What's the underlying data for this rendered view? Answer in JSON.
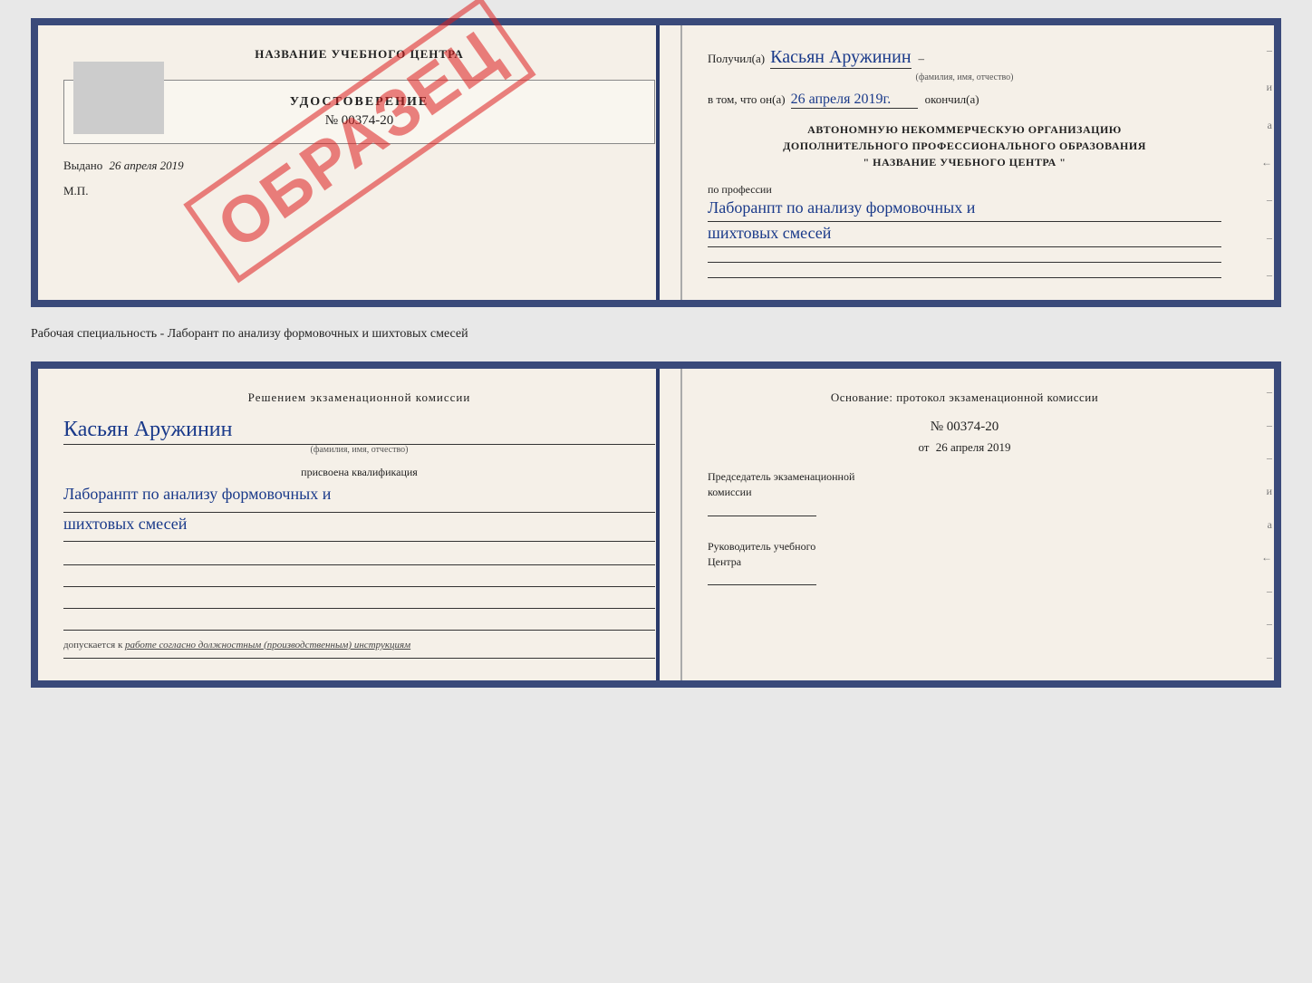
{
  "top_book": {
    "left": {
      "title": "НАЗВАНИЕ УЧЕБНОГО ЦЕНТРА",
      "udostoverenie_label": "УДОСТОВЕРЕНИЕ",
      "number": "№ 00374-20",
      "obrazec": "ОБРАЗЕЦ",
      "vydano_prefix": "Выдано",
      "vydano_date": "26 апреля 2019",
      "mp": "М.П."
    },
    "right": {
      "poluchil_label": "Получил(а)",
      "name_handwritten": "Касьян Аружинин",
      "fio_sublabel": "(фамилия, имя, отчество)",
      "vtom_label": "в том, что он(а)",
      "date_handwritten": "26 апреля 2019г.",
      "okonchil_label": "окончил(а)",
      "org_line1": "АВТОНОМНУЮ НЕКОММЕРЧЕСКУЮ ОРГАНИЗАЦИЮ",
      "org_line2": "ДОПОЛНИТЕЛЬНОГО ПРОФЕССИОНАЛЬНОГО ОБРАЗОВАНИЯ",
      "org_line3": "\"  НАЗВАНИЕ УЧЕБНОГО ЦЕНТРА  \"",
      "po_professii": "по профессии",
      "profession_handwritten_1": "Лаборанпт по анализу формовочных и",
      "profession_handwritten_2": "шихтовых смесей",
      "margin_letters": [
        "и",
        "а",
        "←",
        "–",
        "–",
        "–"
      ]
    }
  },
  "specialty_label": "Рабочая специальность - Лаборант по анализу формовочных и шихтовых смесей",
  "bottom_book": {
    "left": {
      "resolution": "Решением экзаменационной комиссии",
      "name_handwritten": "Касьян Аружинин",
      "fio_sublabel": "(фамилия, имя, отчество)",
      "prisvoena": "присвоена квалификация",
      "qualification_1": "Лаборанпт по анализу формовочных и",
      "qualification_2": "шихтовых смесей",
      "допускается_prefix": "допускается к",
      "допускается_italic": "работе согласно должностным (производственным) инструкциям"
    },
    "right": {
      "osnov": "Основание: протокол экзаменационной комиссии",
      "protocol_number": "№ 00374-20",
      "ot_prefix": "от",
      "protocol_date": "26 апреля 2019",
      "predsedatel_1": "Председатель экзаменационной",
      "predsedatel_2": "комиссии",
      "rukovoditel_1": "Руководитель учебного",
      "rukovoditel_2": "Центра",
      "margin_letters": [
        "–",
        "–",
        "–",
        "и",
        "а",
        "←",
        "–",
        "–",
        "–"
      ]
    }
  }
}
